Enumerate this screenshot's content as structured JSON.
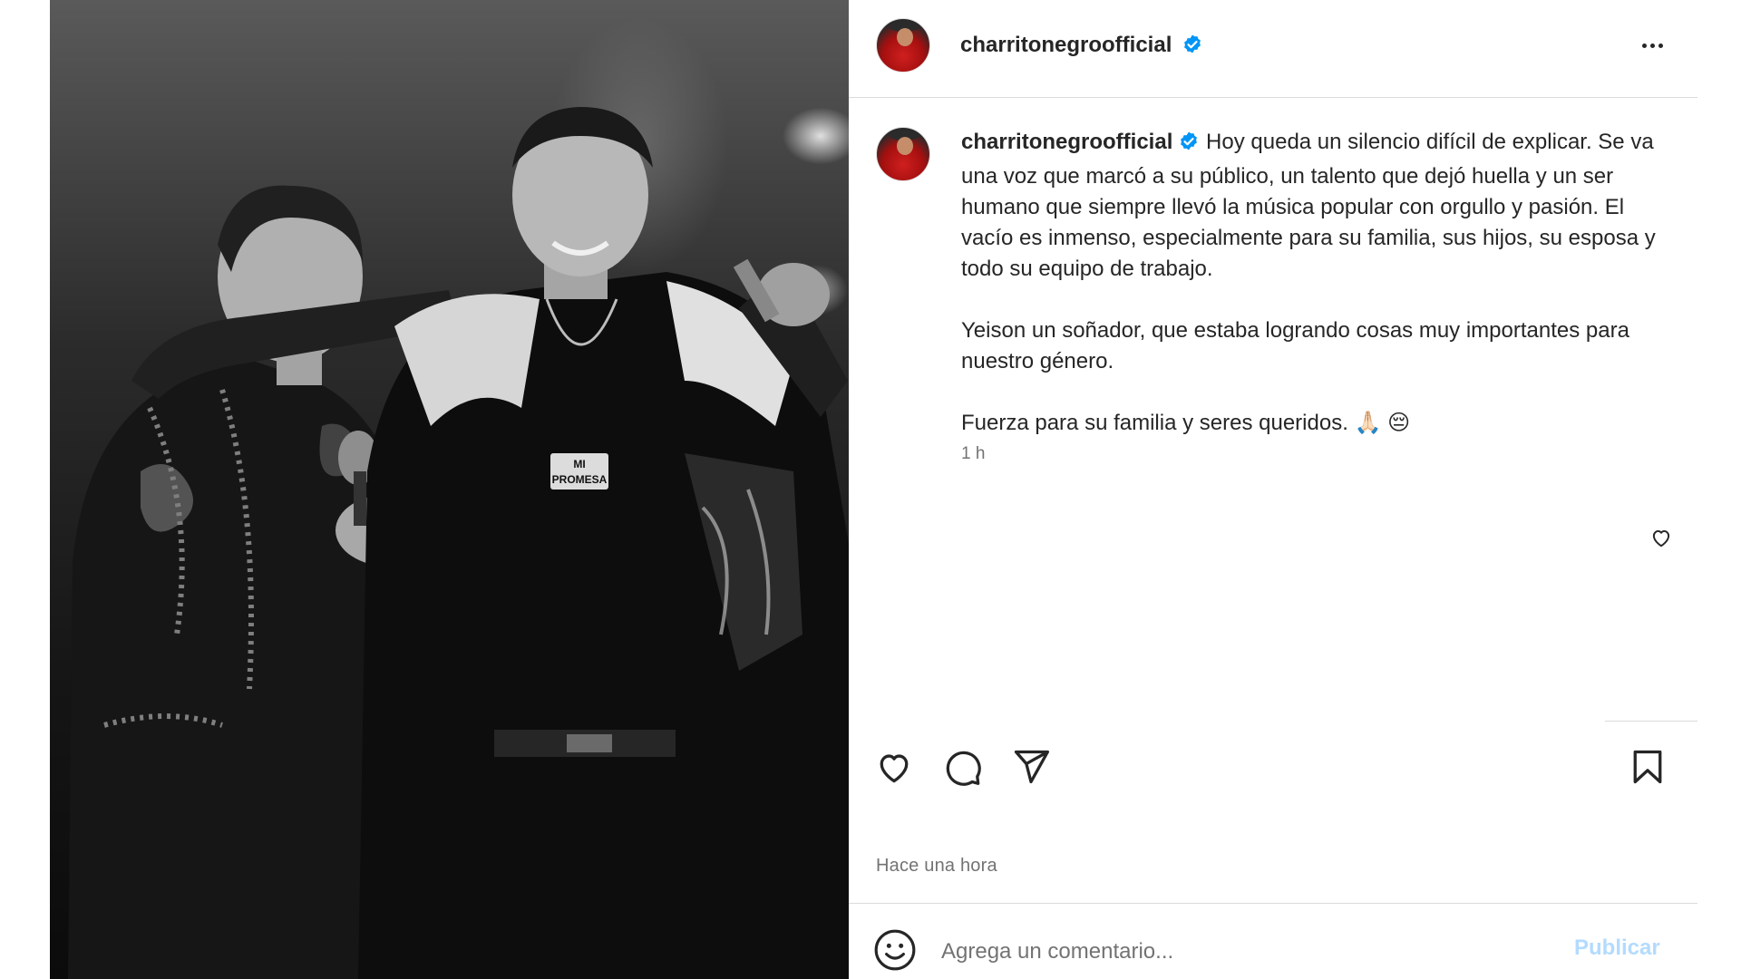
{
  "post": {
    "author": {
      "username": "charritonegroofficial",
      "verified": true
    },
    "caption": {
      "username": "charritonegroofficial",
      "paragraph1": "Hoy queda un silencio difícil de explicar. Se va una voz que marcó a su público, un talento que dejó huella y un ser humano que siempre llevó la música popular con orgullo y pasión. El vacío es inmenso, especialmente para su familia, sus hijos, su esposa y todo su equipo de trabajo.",
      "paragraph2": "Yeison un soñador, que estaba logrando cosas muy importantes para nuestro género.",
      "paragraph3": "Fuerza para su familia y seres queridos.",
      "emojis": "🙏🏻 😔",
      "age": "1 h"
    },
    "timestamp": "Hace una hora"
  },
  "comment": {
    "placeholder": "Agrega un comentario...",
    "publish_label": "Publicar"
  },
  "photo": {
    "necklace_text_top": "MI",
    "necklace_text_bottom": "PROMESA"
  },
  "colors": {
    "verified_blue": "#0095f6",
    "text": "#262626",
    "secondary_text": "#737373",
    "publish_disabled": "#b3dbff",
    "divider": "#dbdbdb",
    "avatar_red": "#d01f1f"
  },
  "icons": [
    "verified-badge-icon",
    "more-options-icon",
    "heart-icon",
    "comment-icon",
    "share-icon",
    "bookmark-icon",
    "emoji-icon"
  ]
}
